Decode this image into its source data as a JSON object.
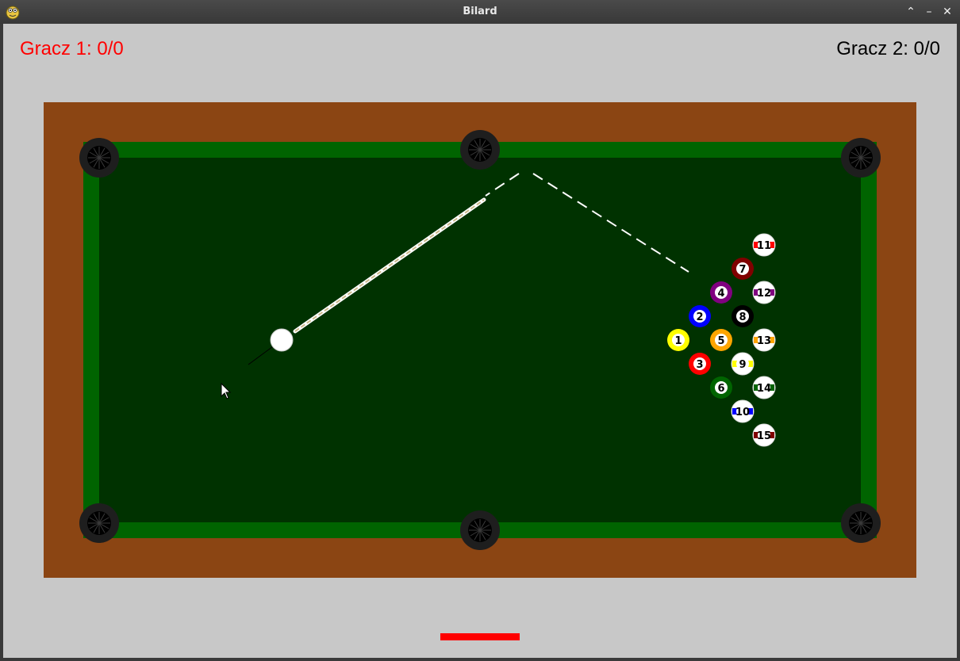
{
  "window": {
    "title": "Bilard"
  },
  "colors": {
    "active_player": "#ff0000",
    "inactive_player": "#000000",
    "frame": "#8b4513",
    "cushion": "#006400",
    "felt": "#003200",
    "pocket": "#1e1e1e",
    "power_bar": "#ff0000"
  },
  "players": [
    {
      "label": "Gracz 1: 0/0",
      "active": true
    },
    {
      "label": "Gracz 2: 0/0",
      "active": false
    }
  ],
  "pockets": [
    "top-left",
    "top-middle",
    "top-right",
    "bottom-left",
    "bottom-middle",
    "bottom-right"
  ],
  "cue_ball": {
    "color": "#ffffff"
  },
  "balls": [
    {
      "number": "1",
      "color": "#ffff00",
      "striped": false
    },
    {
      "number": "2",
      "color": "#0000ff",
      "striped": false
    },
    {
      "number": "3",
      "color": "#ff0000",
      "striped": false
    },
    {
      "number": "4",
      "color": "#800080",
      "striped": false
    },
    {
      "number": "5",
      "color": "#ffa500",
      "striped": false
    },
    {
      "number": "6",
      "color": "#006400",
      "striped": false
    },
    {
      "number": "7",
      "color": "#800000",
      "striped": false
    },
    {
      "number": "8",
      "color": "#000000",
      "striped": false
    },
    {
      "number": "9",
      "color": "#ffff00",
      "striped": true
    },
    {
      "number": "10",
      "color": "#0000ff",
      "striped": true
    },
    {
      "number": "11",
      "color": "#ff0000",
      "striped": true
    },
    {
      "number": "12",
      "color": "#800080",
      "striped": true
    },
    {
      "number": "13",
      "color": "#ffa500",
      "striped": true
    },
    {
      "number": "14",
      "color": "#006400",
      "striped": true
    },
    {
      "number": "15",
      "color": "#800000",
      "striped": true
    }
  ],
  "power": {
    "level": 1.0
  }
}
